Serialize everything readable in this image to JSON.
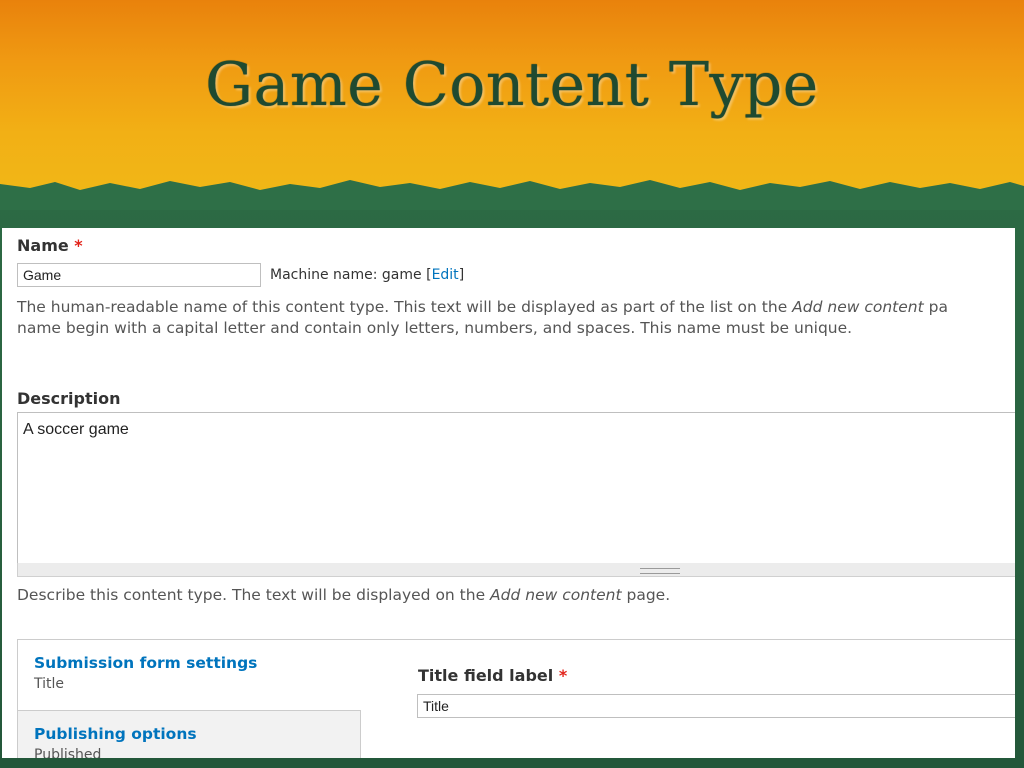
{
  "slide": {
    "title": "Game Content Type",
    "colors": {
      "banner": "#f0a514",
      "background": "#2e6f47",
      "title_text": "#1f4a30"
    }
  },
  "form": {
    "name": {
      "label": "Name",
      "required_mark": "*",
      "value": "Game",
      "machine_name_prefix": "Machine name: game [",
      "machine_name_edit": "Edit",
      "machine_name_suffix": "]",
      "help_line1_prefix": "The human-readable name of this content type. This text will be displayed as part of the list on the ",
      "help_line1_emph": "Add new content",
      "help_line1_suffix": " pa",
      "help_line2": "name begin with a capital letter and contain only letters, numbers, and spaces. This name must be unique."
    },
    "description": {
      "label": "Description",
      "value": "A soccer game",
      "help_prefix": "Describe this content type. The text will be displayed on the ",
      "help_emph": "Add new content",
      "help_suffix": " page."
    },
    "vertical_tabs": [
      {
        "title": "Submission form settings",
        "summary": "Title"
      },
      {
        "title": "Publishing options",
        "summary": "Published"
      }
    ],
    "title_field": {
      "label": "Title field label",
      "required_mark": "*",
      "value": "Title"
    },
    "colors": {
      "link": "#0074bd",
      "required": "#e2231a"
    }
  }
}
